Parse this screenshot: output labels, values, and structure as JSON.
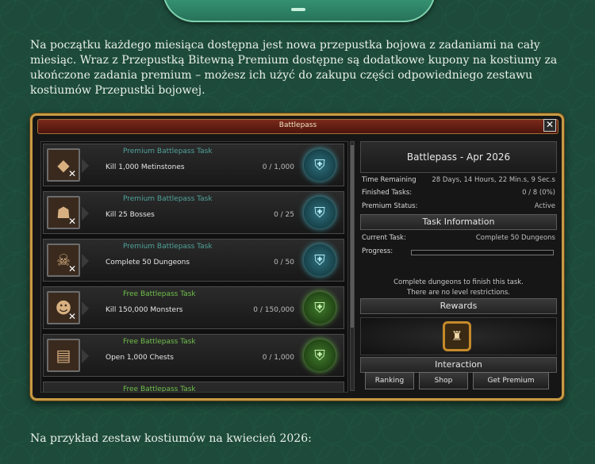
{
  "intro_text": "Na początku każdego miesiąca dostępna jest nowa przepustka bojowa z zadaniami na cały miesiąc. Wraz z Przepustką Bitewną Premium dostępne są dodatkowe kupony na kostiumy za ukończone zadania premium – możesz ich użyć do zakupu części odpowiedniego zestawu kostiumów Przepustki bojowej.",
  "window": {
    "title": "Battlepass",
    "close_symbol": "✕",
    "tasks": [
      {
        "type": "Premium Battlepass Task",
        "name": "Kill 1,000 Metinstones",
        "progress": "0 / 1,000",
        "icon": "metinstone-icon",
        "glyph": "◆"
      },
      {
        "type": "Premium Battlepass Task",
        "name": "Kill 25 Bosses",
        "progress": "0 / 25",
        "icon": "boss-icon",
        "glyph": "☗"
      },
      {
        "type": "Premium Battlepass Task",
        "name": "Complete 50 Dungeons",
        "progress": "0 / 50",
        "icon": "dungeon-icon",
        "glyph": "☠"
      },
      {
        "type": "Free Battlepass Task",
        "name": "Kill 150,000 Monsters",
        "progress": "0 / 150,000",
        "icon": "monster-icon",
        "glyph": "☻"
      },
      {
        "type": "Free Battlepass Task",
        "name": "Open 1,000 Chests",
        "progress": "0 / 1,000",
        "icon": "chest-icon",
        "glyph": "▤"
      },
      {
        "type": "Free Battlepass Task",
        "name": "",
        "progress": "",
        "icon": "task-icon",
        "glyph": ""
      }
    ],
    "panel": {
      "title": "Battlepass - Apr 2026",
      "time_remaining_label": "Time Remaining",
      "time_remaining_value": "28 Days, 14 Hours, 22 Min.s, 9 Sec.s",
      "finished_label": "Finished Tasks:",
      "finished_value": "0 / 8 (0%)",
      "premium_label": "Premium Status:",
      "premium_value": "Active",
      "task_info_header": "Task Information",
      "current_task_label": "Current Task:",
      "current_task_value": "Complete 50 Dungeons",
      "progress_label": "Progress:",
      "progress_fraction": 0,
      "desc_line1": "Complete dungeons to finish this task.",
      "desc_line2": "There are no level restrictions.",
      "rewards_header": "Rewards",
      "interaction_header": "Interaction",
      "btn_ranking": "Ranking",
      "btn_shop": "Shop",
      "btn_premium": "Get Premium"
    }
  },
  "example_text": "Na przykład zestaw kostiumów na kwiecień 2026:"
}
